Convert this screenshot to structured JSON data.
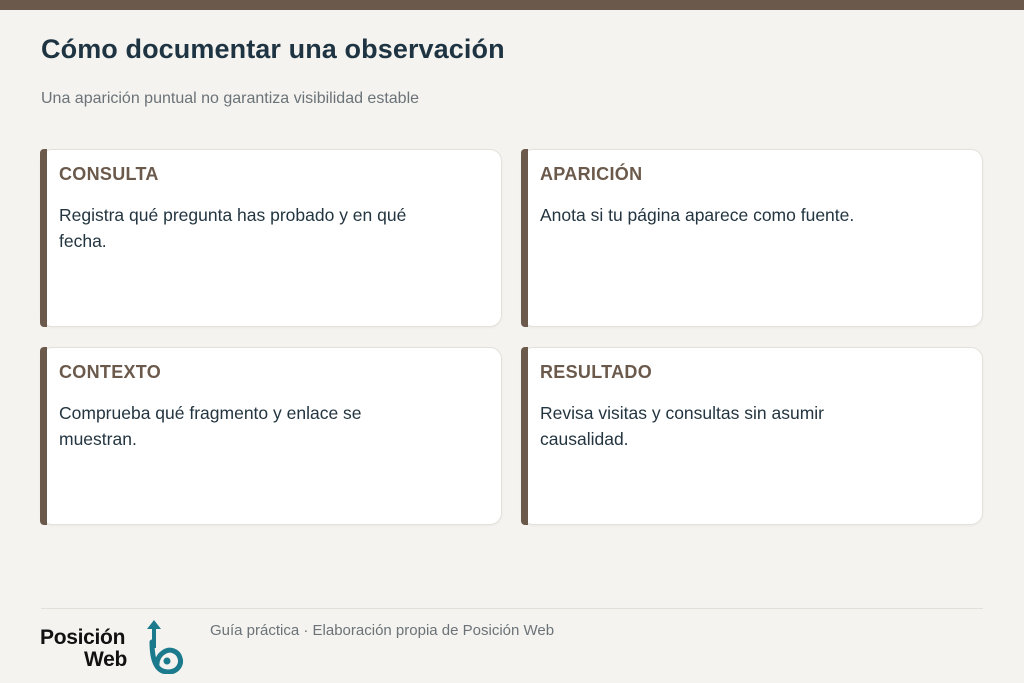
{
  "header": {
    "title": "Cómo documentar una observación",
    "subtitle": "Una aparición puntual no garantiza visibilidad estable"
  },
  "cards": [
    {
      "title": "CONSULTA",
      "text": "Registra qué pregunta has probado y en qué fecha."
    },
    {
      "title": "APARICIÓN",
      "text": "Anota si tu página aparece como fuente."
    },
    {
      "title": "CONTEXTO",
      "text": "Comprueba qué fragmento y enlace se muestran."
    },
    {
      "title": "RESULTADO",
      "text": "Revisa visitas y consultas sin asumir causalidad."
    }
  ],
  "footer": {
    "logo_line1": "Posición",
    "logo_line2": "Web",
    "caption": "Guía práctica · Elaboración propia de Posición Web"
  },
  "colors": {
    "accent": "#6b5a4c",
    "title": "#1e3442",
    "background": "#f4f3ef",
    "logo_mark": "#1b7a8c"
  }
}
